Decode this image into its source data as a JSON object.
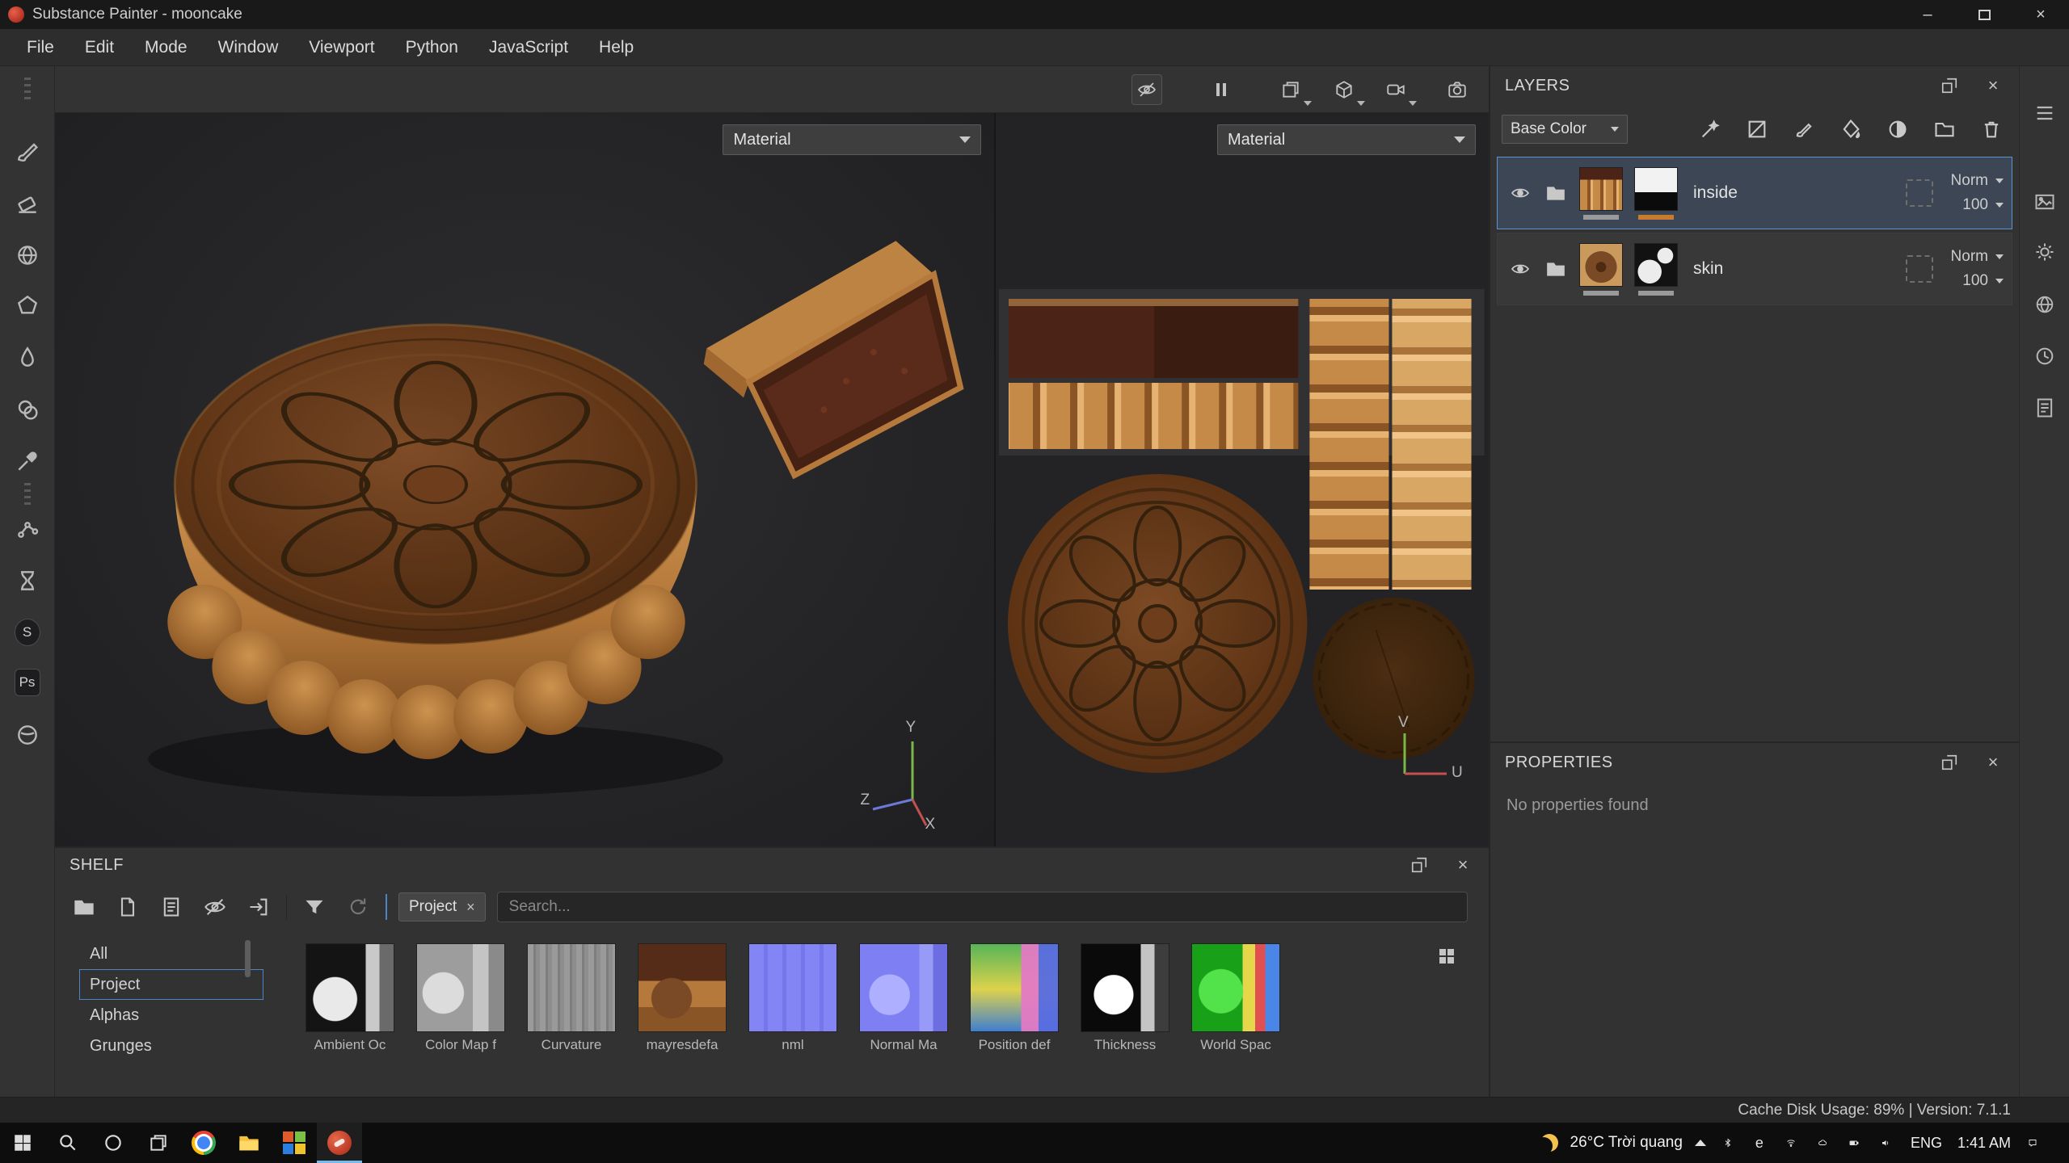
{
  "window": {
    "title": "Substance Painter - mooncake"
  },
  "icons": {
    "minimize": "–",
    "close": "×",
    "photoshop_badge": "Ps",
    "substance_badge": "S",
    "edge_badge": "e"
  },
  "menu": {
    "items": [
      "File",
      "Edit",
      "Mode",
      "Window",
      "Viewport",
      "Python",
      "JavaScript",
      "Help"
    ]
  },
  "viewport_3d": {
    "shading_mode": "Material",
    "axis_x": "X",
    "axis_y": "Y",
    "axis_z": "Z"
  },
  "viewport_2d": {
    "shading_mode": "Material",
    "axis_u": "U",
    "axis_v": "V"
  },
  "layers_panel": {
    "title": "LAYERS",
    "channel": "Base Color",
    "selected_layer": "inside",
    "layers": [
      {
        "name": "inside",
        "blend_mode": "Norm",
        "opacity": "100"
      },
      {
        "name": "skin",
        "blend_mode": "Norm",
        "opacity": "100"
      }
    ]
  },
  "properties_panel": {
    "title": "PROPERTIES",
    "empty_message": "No properties found"
  },
  "shelf": {
    "title": "SHELF",
    "filter_tag": "Project",
    "search_placeholder": "Search...",
    "selected_category": "Project",
    "categories": [
      "All",
      "Project",
      "Alphas",
      "Grunges"
    ],
    "assets": [
      {
        "label": "Ambient Oc"
      },
      {
        "label": "Color Map f"
      },
      {
        "label": "Curvature"
      },
      {
        "label": "mayresdefa"
      },
      {
        "label": "nml"
      },
      {
        "label": "Normal Ma"
      },
      {
        "label": "Position def"
      },
      {
        "label": "Thickness"
      },
      {
        "label": "World Spac"
      }
    ]
  },
  "status_bar": {
    "text": "Cache Disk Usage: 89% | Version: 7.1.1"
  },
  "taskbar": {
    "weather": "26°C Trời quang",
    "language": "ENG",
    "time": "1:41 AM"
  },
  "colors": {
    "accent_blue": "#4a86c5",
    "accent_orange": "#c87a2e",
    "selection_border": "#5b94cf"
  }
}
